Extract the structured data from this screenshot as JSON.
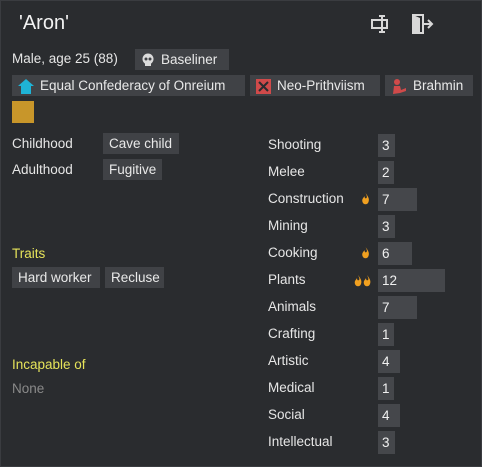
{
  "pawn": {
    "name": "'Aron'",
    "summary": "Male, age 25 (88)",
    "xenotype": "Baseliner",
    "faction": "Equal Confederacy of Onreium",
    "ideoligion": "Neo-Prithviism",
    "role": "Brahmin"
  },
  "backstory": {
    "childhood_label": "Childhood",
    "childhood_value": "Cave child",
    "adulthood_label": "Adulthood",
    "adulthood_value": "Fugitive"
  },
  "traits": {
    "heading": "Traits",
    "items": [
      "Hard worker",
      "Recluse"
    ]
  },
  "incapable": {
    "heading": "Incapable of",
    "value": "None"
  },
  "skills": [
    {
      "name": "Shooting",
      "level": 3,
      "passion": 0
    },
    {
      "name": "Melee",
      "level": 2,
      "passion": 0
    },
    {
      "name": "Construction",
      "level": 7,
      "passion": 1
    },
    {
      "name": "Mining",
      "level": 3,
      "passion": 0
    },
    {
      "name": "Cooking",
      "level": 6,
      "passion": 1
    },
    {
      "name": "Plants",
      "level": 12,
      "passion": 2
    },
    {
      "name": "Animals",
      "level": 7,
      "passion": 0
    },
    {
      "name": "Crafting",
      "level": 1,
      "passion": 0
    },
    {
      "name": "Artistic",
      "level": 4,
      "passion": 0
    },
    {
      "name": "Medical",
      "level": 1,
      "passion": 0
    },
    {
      "name": "Social",
      "level": 4,
      "passion": 0
    },
    {
      "name": "Intellectual",
      "level": 3,
      "passion": 0
    }
  ],
  "colors": {
    "section_heading": "#e6e35a",
    "chip_bg": "#404246",
    "faction_icon": "#1fb3d6",
    "ideo_icon": "#d04a4a",
    "role_icon": "#d04a4a",
    "favorite_color": "#c8962a",
    "flame": "#f0a020"
  },
  "icons": {
    "rename": "rename-icon",
    "banish": "banish-icon",
    "xenotype": "skull-icon",
    "faction": "house-icon",
    "ideoligion": "ideoligion-icon",
    "role": "role-icon",
    "passion": "flame-icon"
  }
}
